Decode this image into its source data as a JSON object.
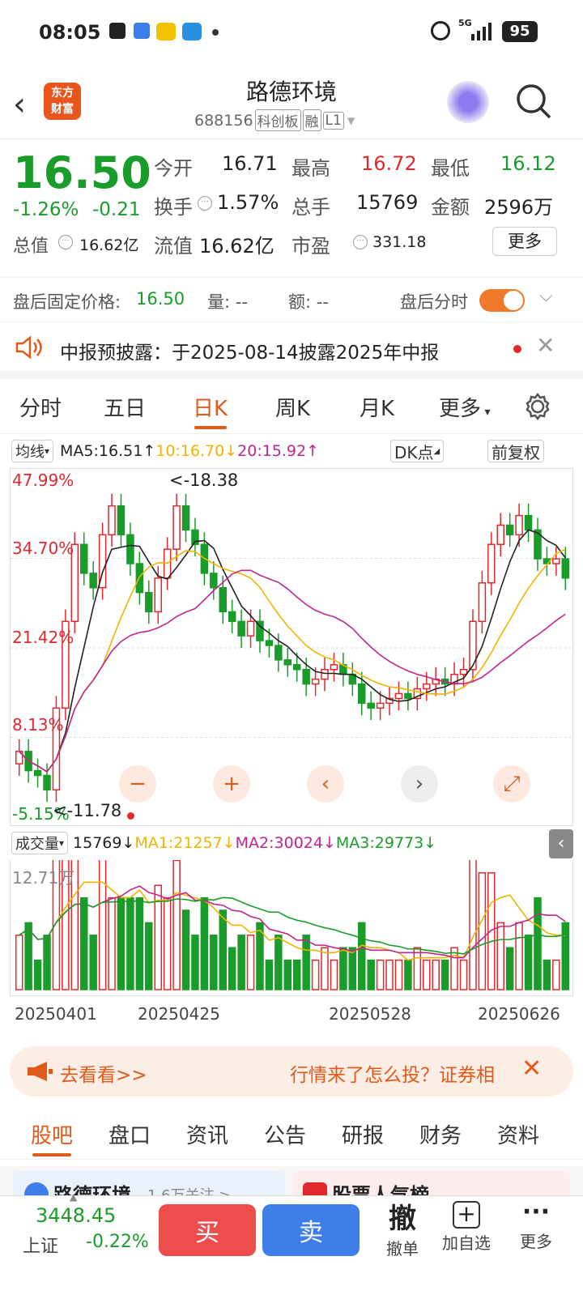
{
  "status": {
    "time": "08:05",
    "net": "5G",
    "battery": "95"
  },
  "header": {
    "title": "路德环境",
    "code": "688156",
    "board": "科创板",
    "margin": "融",
    "level": "L1",
    "logo_line1": "东方",
    "logo_line2": "财富"
  },
  "quote": {
    "price": "16.50",
    "pct": "-1.26%",
    "chg": "-0.21",
    "open_label": "今开",
    "open": "16.71",
    "high_label": "最高",
    "high": "16.72",
    "low_label": "最低",
    "low": "16.12",
    "turn_label": "换手",
    "turn": "1.57%",
    "vol_label": "总手",
    "vol": "15769",
    "amt_label": "金额",
    "amt": "2596万",
    "mcap_label": "总值",
    "mcap": "16.62亿",
    "float_label": "流值",
    "float": "16.62亿",
    "pe_label": "市盈",
    "pe": "331.18",
    "more": "更多"
  },
  "after": {
    "fixed_label": "盘后固定价格:",
    "fixed_price": "16.50",
    "qty_label": "量: --",
    "amt_label": "额: --",
    "timeshare_label": "盘后分时"
  },
  "notice": {
    "text": "中报预披露：于2025-08-14披露2025年中报"
  },
  "tabs": [
    "分时",
    "五日",
    "日K",
    "周K",
    "月K",
    "更多"
  ],
  "ma": {
    "selector": "均线",
    "ma5": "MA5:16.51",
    "ma10": "10:16.70",
    "ma20": "20:15.92",
    "dk": "DK点",
    "fq": "前复权"
  },
  "vol": {
    "selector": "成交量",
    "cur": "15769",
    "ma1": "MA1:21257",
    "ma2": "MA2:30024",
    "ma3": "MA3:29773",
    "max": "12.71万"
  },
  "chart_data": {
    "type": "candlestick",
    "y_tick_labels": [
      "47.99%",
      "34.70%",
      "21.42%",
      "8.13%",
      "-5.15%"
    ],
    "max_mark": "<-18.38",
    "min_mark": "<-11.78",
    "x_tick_labels": [
      "20250401",
      "20250425",
      "20250528",
      "20250626"
    ],
    "closes": [
      12.9,
      12.5,
      12.4,
      12.1,
      13.8,
      15.6,
      17.2,
      16.6,
      16.3,
      17.4,
      18.0,
      17.4,
      16.8,
      16.2,
      15.8,
      16.5,
      17.1,
      18.0,
      17.5,
      17.2,
      16.6,
      16.3,
      15.8,
      15.6,
      15.3,
      15.6,
      15.2,
      15.1,
      14.8,
      14.7,
      14.6,
      14.3,
      14.4,
      14.6,
      14.7,
      14.5,
      14.3,
      13.9,
      13.8,
      13.9,
      14.0,
      14.1,
      14.0,
      14.2,
      14.3,
      14.4,
      14.3,
      14.5,
      14.6,
      15.6,
      16.4,
      17.2,
      17.6,
      17.4,
      17.8,
      17.5,
      16.9,
      16.8,
      16.9,
      16.5
    ]
  },
  "banner": {
    "left": "去看看>>",
    "right": "行情来了怎么投？证券相"
  },
  "bottom_tabs": [
    "股吧",
    "盘口",
    "资讯",
    "公告",
    "研报",
    "财务",
    "资料"
  ],
  "peek": {
    "left": "路德环境",
    "left_sub": "1.6万关注 >",
    "right": "股票人气榜"
  },
  "footer": {
    "index_value": "3448.45",
    "index_name": "上证",
    "index_pct": "-0.22%",
    "buy": "买",
    "sell": "卖",
    "cancel_big": "撤",
    "cancel": "撤单",
    "add": "加自选",
    "more": "更多"
  },
  "colors": {
    "up": "#e0282d",
    "down": "#1a9c2b",
    "accent": "#e05a1a",
    "buy": "#ee4d4d",
    "sell": "#3d7ee8",
    "ma5": "#222222",
    "ma10": "#f0b400",
    "ma20": "#c2268c"
  }
}
